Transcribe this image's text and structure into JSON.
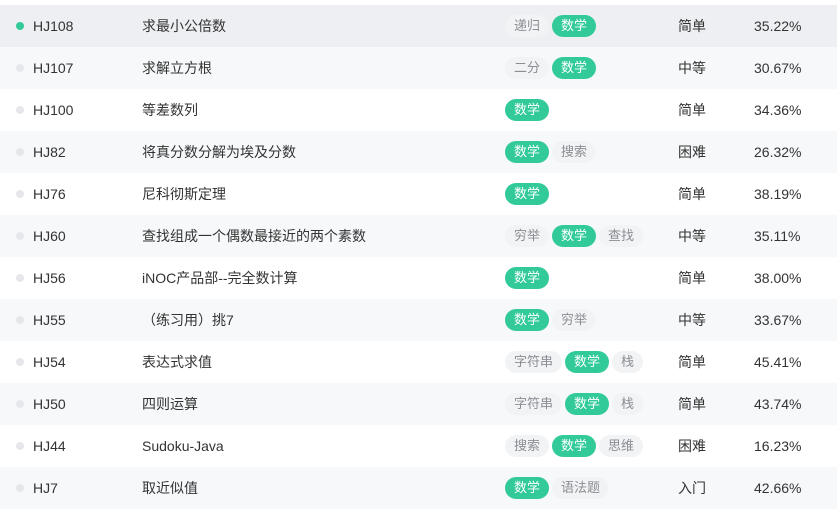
{
  "colors": {
    "accent": "#32ca99",
    "row_shade": "#f7f8fa",
    "row_highlight": "#eeeff2",
    "tag_bg": "#f2f3f5",
    "tag_text": "#8a8d93",
    "dot_default": "#e6e7ea"
  },
  "rows": [
    {
      "id": "HJ108",
      "title": "求最小公倍数",
      "tags": [
        "递归",
        "数学"
      ],
      "difficulty": "简单",
      "pass_rate": "35.22%",
      "done": true
    },
    {
      "id": "HJ107",
      "title": "求解立方根",
      "tags": [
        "二分",
        "数学"
      ],
      "difficulty": "中等",
      "pass_rate": "30.67%",
      "done": false
    },
    {
      "id": "HJ100",
      "title": "等差数列",
      "tags": [
        "数学"
      ],
      "difficulty": "简单",
      "pass_rate": "34.36%",
      "done": false
    },
    {
      "id": "HJ82",
      "title": "将真分数分解为埃及分数",
      "tags": [
        "数学",
        "搜索"
      ],
      "difficulty": "困难",
      "pass_rate": "26.32%",
      "done": false
    },
    {
      "id": "HJ76",
      "title": "尼科彻斯定理",
      "tags": [
        "数学"
      ],
      "difficulty": "简单",
      "pass_rate": "38.19%",
      "done": false
    },
    {
      "id": "HJ60",
      "title": "查找组成一个偶数最接近的两个素数",
      "tags": [
        "穷举",
        "数学",
        "查找"
      ],
      "difficulty": "中等",
      "pass_rate": "35.11%",
      "done": false
    },
    {
      "id": "HJ56",
      "title": "iNOC产品部--完全数计算",
      "tags": [
        "数学"
      ],
      "difficulty": "简单",
      "pass_rate": "38.00%",
      "done": false
    },
    {
      "id": "HJ55",
      "title": "（练习用）挑7",
      "tags": [
        "数学",
        "穷举"
      ],
      "difficulty": "中等",
      "pass_rate": "33.67%",
      "done": false
    },
    {
      "id": "HJ54",
      "title": "表达式求值",
      "tags": [
        "字符串",
        "数学",
        "栈"
      ],
      "difficulty": "简单",
      "pass_rate": "45.41%",
      "done": false
    },
    {
      "id": "HJ50",
      "title": "四则运算",
      "tags": [
        "字符串",
        "数学",
        "栈"
      ],
      "difficulty": "简单",
      "pass_rate": "43.74%",
      "done": false
    },
    {
      "id": "HJ44",
      "title": "Sudoku-Java",
      "tags": [
        "搜索",
        "数学",
        "思维"
      ],
      "difficulty": "困难",
      "pass_rate": "16.23%",
      "done": false
    },
    {
      "id": "HJ7",
      "title": "取近似值",
      "tags": [
        "数学",
        "语法题"
      ],
      "difficulty": "入门",
      "pass_rate": "42.66%",
      "done": false
    }
  ]
}
